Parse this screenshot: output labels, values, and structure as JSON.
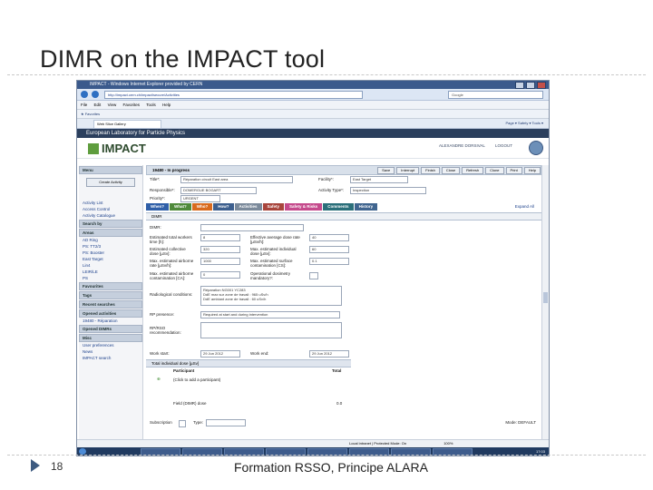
{
  "slide": {
    "title": "DIMR on the IMPACT tool",
    "number": "18",
    "footer": "Formation RSSO, Principe ALARA"
  },
  "browser": {
    "window_title": "IMPACT - Windows Internet Explorer provided by CERN",
    "address": "http://impact.cern.ch/impact/secure/Activities",
    "search_placeholder": "Google",
    "menu": [
      "File",
      "Edit",
      "View",
      "Favorites",
      "Tools",
      "Help"
    ],
    "favorites_label": "Favorites",
    "tab_label": "Web Slice Gallery",
    "command_icons": "Page ▾  Safety ▾  Tools ▾",
    "status_text": "Local intranet | Protected Mode: On",
    "zoom": "100%",
    "clock": "17:03"
  },
  "app": {
    "banner": "European Laboratory for Particle Physics",
    "logo": "IMPACT",
    "user": "ALEXANDRE DORSIVAL",
    "logout": "LOGOUT",
    "left_panel": {
      "menu_head": "Menu",
      "create_button": "Create Activity",
      "links": [
        "Activity List",
        "Access Control",
        "Activity Catalogue"
      ],
      "search_head": "Search by",
      "areas_head": "Areas",
      "areas": [
        "AD Ring",
        "PS: TT2/3",
        "PS: Booster",
        "East Target",
        "Lin4",
        "LEIR/LE",
        "PS"
      ],
      "favourites_head": "Favourites",
      "tags_head": "Tags",
      "recent_head": "Recent searches",
      "opened_head": "Opened activities",
      "opened_item": "19480 - Réparation",
      "opened_dimrs_head": "Opened DIMRs",
      "misc_head": "Misc",
      "misc_items": [
        "User preferences",
        "News",
        "IMPACT search"
      ]
    },
    "header": {
      "title": "19480 - In progress",
      "buttons": [
        "Save",
        "Interrupt",
        "Finish",
        "Close",
        "Refresh",
        "Clone",
        "Print",
        "Help"
      ]
    },
    "form": {
      "title_label": "Title*:",
      "title_value": "Réparation circuit East area",
      "facility_label": "Facility*:",
      "facility_value": "East Target",
      "responsible_label": "Responsible*:",
      "responsible_value": "DOMERGUE BOGART",
      "activity_type_label": "Activity Type*:",
      "activity_type_value": "Inspection",
      "priority_label": "Priority*:",
      "priority_value": "URGENT"
    },
    "color_tabs": [
      {
        "label": "When?",
        "color": "#2f5fa8"
      },
      {
        "label": "What?",
        "color": "#4f8a3a"
      },
      {
        "label": "Who?",
        "color": "#d86a1e"
      },
      {
        "label": "How?",
        "color": "#3d5f8e"
      },
      {
        "label": "Activities",
        "color": "#7b8a9b"
      },
      {
        "label": "Safety",
        "color": "#a8453c"
      },
      {
        "label": "Safety & Risks",
        "color": "#c54a8c"
      },
      {
        "label": "Comments",
        "color": "#2b6f7a"
      },
      {
        "label": "History",
        "color": "#40658f"
      }
    ],
    "expand_all": "Expand All",
    "dimr": {
      "section": "DIMR",
      "dimr_label": "DIMR:",
      "est_total_time_label": "Estimated total workers time [h]:",
      "est_total_time_value": "8",
      "eff_dose_rate_label": "Effective average dose rate [µSv/h]:",
      "eff_dose_rate_value": "40",
      "est_collective_dose_label": "Estimated collective dose [µSv]:",
      "est_collective_dose_value": "320",
      "max_indiv_dose_label": "Max. estimated individual dose [µSv]:",
      "max_indiv_dose_value": "60",
      "max_air_label": "Max. estimated airborne rate [µSv/h]:",
      "max_air_value": "1000",
      "max_surface_label": "Max. estimated surface contamination [CS]:",
      "max_surface_value": "0.1",
      "max_airborne_label": "Max. estimated airborne contamination [CA]:",
      "max_airborne_value": "0",
      "dosimetry_label": "Operational dosimetry mandatory?:",
      "radiological_label": "Radiological conditions:",
      "radiological_text": "Réparation NG001 YC283\nDdE max sur zone de travail : 965 uSv/h\nDdE ambiant zone de travail : 60 uSv/h",
      "rp_presence_label": "RP presence:",
      "rp_presence_value": "Required at start and during intervention",
      "rp_reco_label": "RP/RSO recommendation:",
      "work_start_label": "Work start:",
      "work_start_value": "29 Jun 2012",
      "work_end_label": "Work end:",
      "work_end_value": "29 Jun 2012",
      "indiv_dose_head": "Total individual dose [µSv]",
      "participant_col": "Participant",
      "total_col": "Total",
      "add_participant": "(Click to add a participant)",
      "field_dose_label": "Field (DIMR) dose",
      "field_dose_value": "0.0"
    },
    "subscription_label": "Subscription",
    "type_label": "Type:",
    "mode_label": "Mode: DEFAULT"
  }
}
